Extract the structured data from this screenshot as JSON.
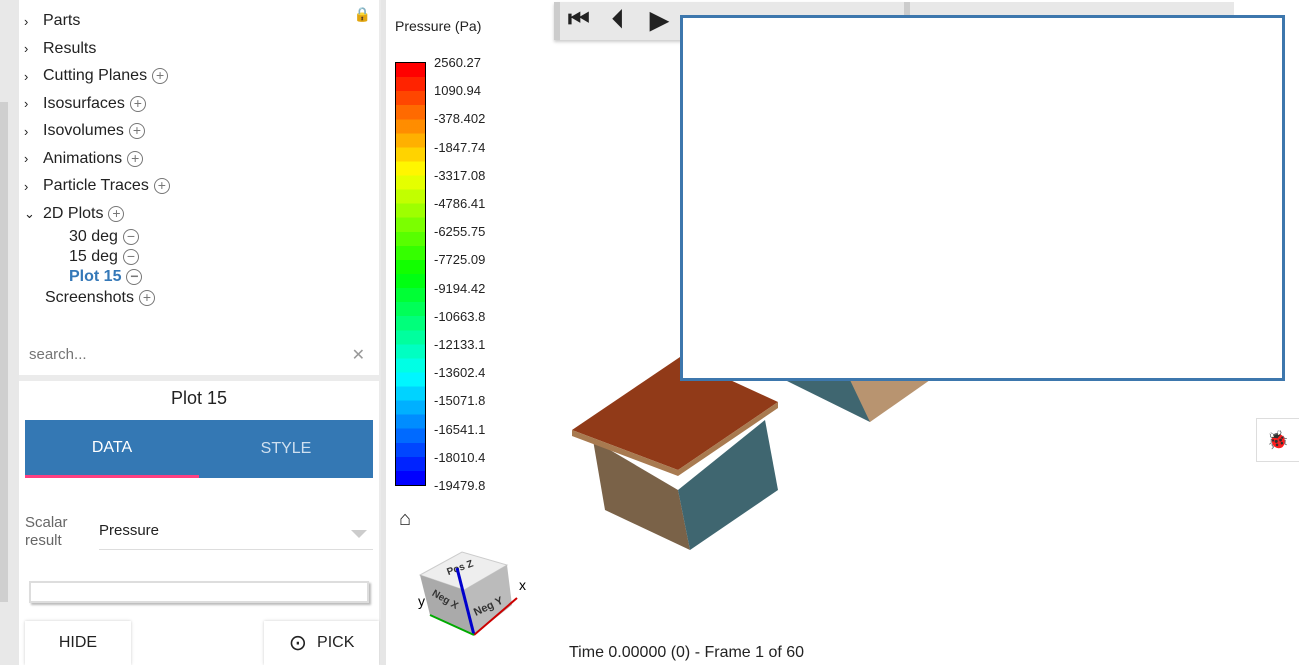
{
  "tree": {
    "items": [
      {
        "label": "Parts",
        "expand": "›",
        "add": false
      },
      {
        "label": "Results",
        "expand": "›",
        "add": false
      },
      {
        "label": "Cutting Planes",
        "expand": "›",
        "add": true
      },
      {
        "label": "Isosurfaces",
        "expand": "›",
        "add": true
      },
      {
        "label": "Isovolumes",
        "expand": "›",
        "add": true
      },
      {
        "label": "Animations",
        "expand": "›",
        "add": true
      },
      {
        "label": "Particle Traces",
        "expand": "›",
        "add": true
      },
      {
        "label": "2D Plots",
        "expand": "⌄",
        "add": true
      }
    ],
    "children": [
      "30 deg",
      "15 deg",
      "Plot 15"
    ],
    "last": "Screenshots",
    "search_placeholder": "search..."
  },
  "props": {
    "title": "Plot 15",
    "tabs": [
      "DATA",
      "STYLE"
    ],
    "scalar_label_1": "Scalar",
    "scalar_label_2": "result",
    "scalar_value": "Pressure",
    "hide": "HIDE",
    "pick": "PICK"
  },
  "legend": {
    "title": "Pressure (Pa)",
    "labels": [
      "2560.27",
      "1090.94",
      "-378.402",
      "-1847.74",
      "-3317.08",
      "-4786.41",
      "-6255.75",
      "-7725.09",
      "-9194.42",
      "-10663.8",
      "-12133.1",
      "-13602.4",
      "-15071.8",
      "-16541.1",
      "-18010.4",
      "-19479.8"
    ]
  },
  "triad": {
    "pos_z": "Pos Z",
    "neg_x": "Neg X",
    "neg_y": "Neg Y",
    "x": "x",
    "y": "y"
  },
  "status": "Time 0.00000 (0) - Frame 1 of 60",
  "colors": {
    "accent": "#3478b4",
    "tab_indicator": "#ff4081",
    "selected": "#3478b8"
  }
}
